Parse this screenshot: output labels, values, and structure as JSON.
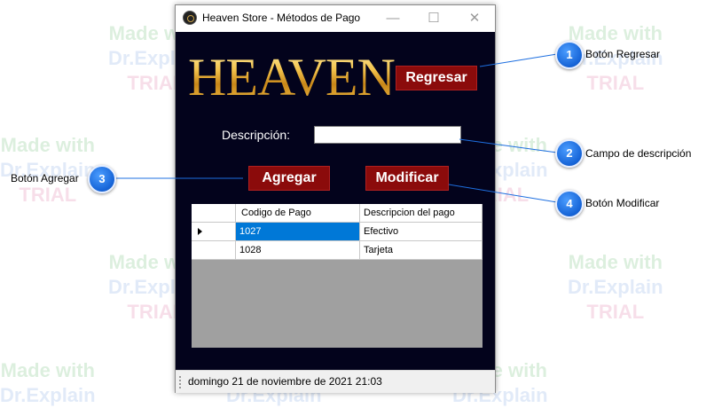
{
  "watermark": {
    "line1": "Made with",
    "line2": "Dr.Explain",
    "line3": "TRIAL"
  },
  "window": {
    "title": "Heaven Store - Métodos de Pago",
    "controls": {
      "minimize": "—",
      "maximize": "☐",
      "close": "✕"
    }
  },
  "form": {
    "logo_text": "HEAVEN",
    "regresar_label": "Regresar",
    "descripcion_label": "Descripción:",
    "descripcion_value": "",
    "agregar_label": "Agregar",
    "modificar_label": "Modificar"
  },
  "grid": {
    "columns": [
      "Codigo de Pago",
      "Descripcion del pago"
    ],
    "rows": [
      {
        "codigo": "1027",
        "descripcion": "Efectivo",
        "selected": true
      },
      {
        "codigo": "1028",
        "descripcion": "Tarjeta",
        "selected": false
      }
    ]
  },
  "status": {
    "text": "domingo 21 de noviembre de 2021  21:03"
  },
  "callouts": [
    {
      "number": "1",
      "label": "Botón Regresar"
    },
    {
      "number": "2",
      "label": "Campo de descripción"
    },
    {
      "number": "3",
      "label": "Botón Agregar"
    },
    {
      "number": "4",
      "label": "Botón Modificar"
    }
  ],
  "colors": {
    "client_bg": "#03031c",
    "button_red": "#8b0b0b",
    "selection_blue": "#0078d7",
    "callout_blue": "#1563d6"
  }
}
